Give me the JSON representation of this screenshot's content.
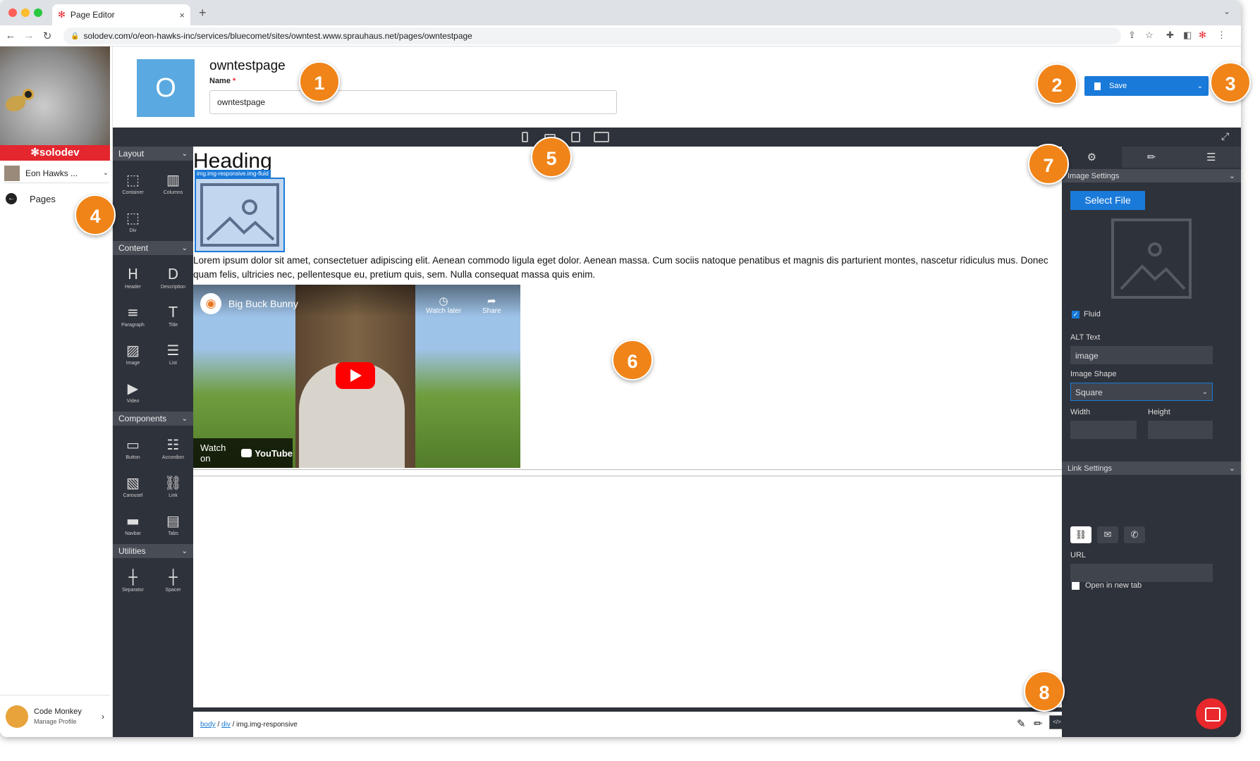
{
  "browser": {
    "tab_title": "Page Editor",
    "url": "solodev.com/o/eon-hawks-inc/services/bluecomet/sites/owntest.www.sprauhaus.net/pages/owntestpage",
    "new_tab_symbol": "+",
    "close_symbol": "×"
  },
  "sidebar": {
    "brand": "✻solodev",
    "org_name": "Eon Hawks ...",
    "pages_label": "Pages",
    "profile_name": "Code Monkey",
    "profile_link": "Manage Profile"
  },
  "header": {
    "page_letter": "O",
    "page_title": "owntestpage",
    "name_label": "Name",
    "required_mark": "*",
    "name_value": "owntestpage",
    "save_label": "Save"
  },
  "blocks": {
    "categories": [
      {
        "label": "Layout",
        "items": [
          {
            "label": "Container",
            "icon": "container-icon",
            "glyph": "⬚"
          },
          {
            "label": "Columns",
            "icon": "columns-icon",
            "glyph": "▥"
          },
          {
            "label": "Div",
            "icon": "div-icon",
            "glyph": "⬚"
          }
        ]
      },
      {
        "label": "Content",
        "items": [
          {
            "label": "Header",
            "icon": "header-icon",
            "glyph": "H"
          },
          {
            "label": "Description",
            "icon": "description-icon",
            "glyph": "D"
          },
          {
            "label": "Paragraph",
            "icon": "paragraph-icon",
            "glyph": "≡"
          },
          {
            "label": "Title",
            "icon": "title-icon",
            "glyph": "T"
          },
          {
            "label": "Image",
            "icon": "image-icon",
            "glyph": "▨"
          },
          {
            "label": "List",
            "icon": "list-icon",
            "glyph": "☰"
          },
          {
            "label": "Video",
            "icon": "video-icon",
            "glyph": "▶"
          }
        ]
      },
      {
        "label": "Components",
        "items": [
          {
            "label": "Button",
            "icon": "button-icon",
            "glyph": "▭"
          },
          {
            "label": "Accordion",
            "icon": "accordion-icon",
            "glyph": "☷"
          },
          {
            "label": "Carousel",
            "icon": "carousel-icon",
            "glyph": "▧"
          },
          {
            "label": "Link",
            "icon": "link-icon",
            "glyph": "⛓"
          },
          {
            "label": "Navbar",
            "icon": "navbar-icon",
            "glyph": "▬"
          },
          {
            "label": "Tabs",
            "icon": "tabs-icon",
            "glyph": "▤"
          }
        ]
      },
      {
        "label": "Utilities",
        "items": [
          {
            "label": "Separator",
            "icon": "separator-icon",
            "glyph": "┼"
          },
          {
            "label": "Spacer",
            "icon": "spacer-icon",
            "glyph": "┼"
          }
        ]
      }
    ]
  },
  "canvas": {
    "heading": "Heading",
    "selected_label": "img.img-responsive.img-fluid",
    "paragraph": "Lorem ipsum dolor sit amet, consectetuer adipiscing elit. Aenean commodo ligula eget dolor. Aenean massa. Cum sociis natoque penatibus et magnis dis parturient montes, nascetur ridiculus mus. Donec quam felis, ultricies nec, pellentesque eu, pretium quis, sem. Nulla consequat massa quis enim.",
    "video": {
      "title": "Big Buck Bunny",
      "watch_later": "Watch later",
      "share": "Share",
      "watch_on": "Watch on",
      "youtube": "YouTube"
    }
  },
  "breadcrumb": {
    "items": [
      "body",
      "div"
    ],
    "current": "img.img-responsive",
    "separator": "/"
  },
  "properties": {
    "image_settings": "Image Settings",
    "select_file": "Select File",
    "fluid_label": "Fluid",
    "alt_label": "ALT Text",
    "alt_value": "image",
    "shape_label": "Image Shape",
    "shape_value": "Square",
    "width_label": "Width",
    "height_label": "Height",
    "link_settings": "Link Settings",
    "url_label": "URL",
    "newtab_label": "Open in new tab"
  },
  "badges": [
    "1",
    "2",
    "3",
    "4",
    "5",
    "6",
    "7",
    "8"
  ],
  "colors": {
    "accent": "#1a7ad9",
    "brand_red": "#e4262e",
    "badge_orange": "#f08419",
    "panel_dark": "#2e323a"
  }
}
